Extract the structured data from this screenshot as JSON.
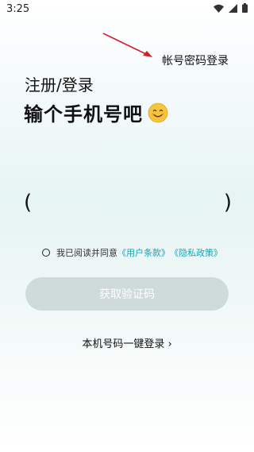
{
  "status_bar": {
    "time": "3:25"
  },
  "header": {
    "account_login_label": "帐号密码登录"
  },
  "title": {
    "small": "注册/登录",
    "big": "输个手机号吧"
  },
  "phone": {
    "value": "",
    "left_paren": "(",
    "right_paren": ")"
  },
  "agreement": {
    "prefix": "我已阅读并同意",
    "user_terms": "《用户条款》",
    "privacy_policy": "《隐私政策》",
    "checked": false
  },
  "buttons": {
    "get_code": "获取验证码",
    "onekey_login": "本机号码一键登录 ›"
  },
  "colors": {
    "link": "#1aa3b5",
    "button_disabled": "#cfdadb",
    "arrow": "#d0202a"
  },
  "icons": [
    "wifi-icon",
    "signal-icon",
    "battery-icon",
    "smile-emoji-icon",
    "red-arrow-icon"
  ]
}
